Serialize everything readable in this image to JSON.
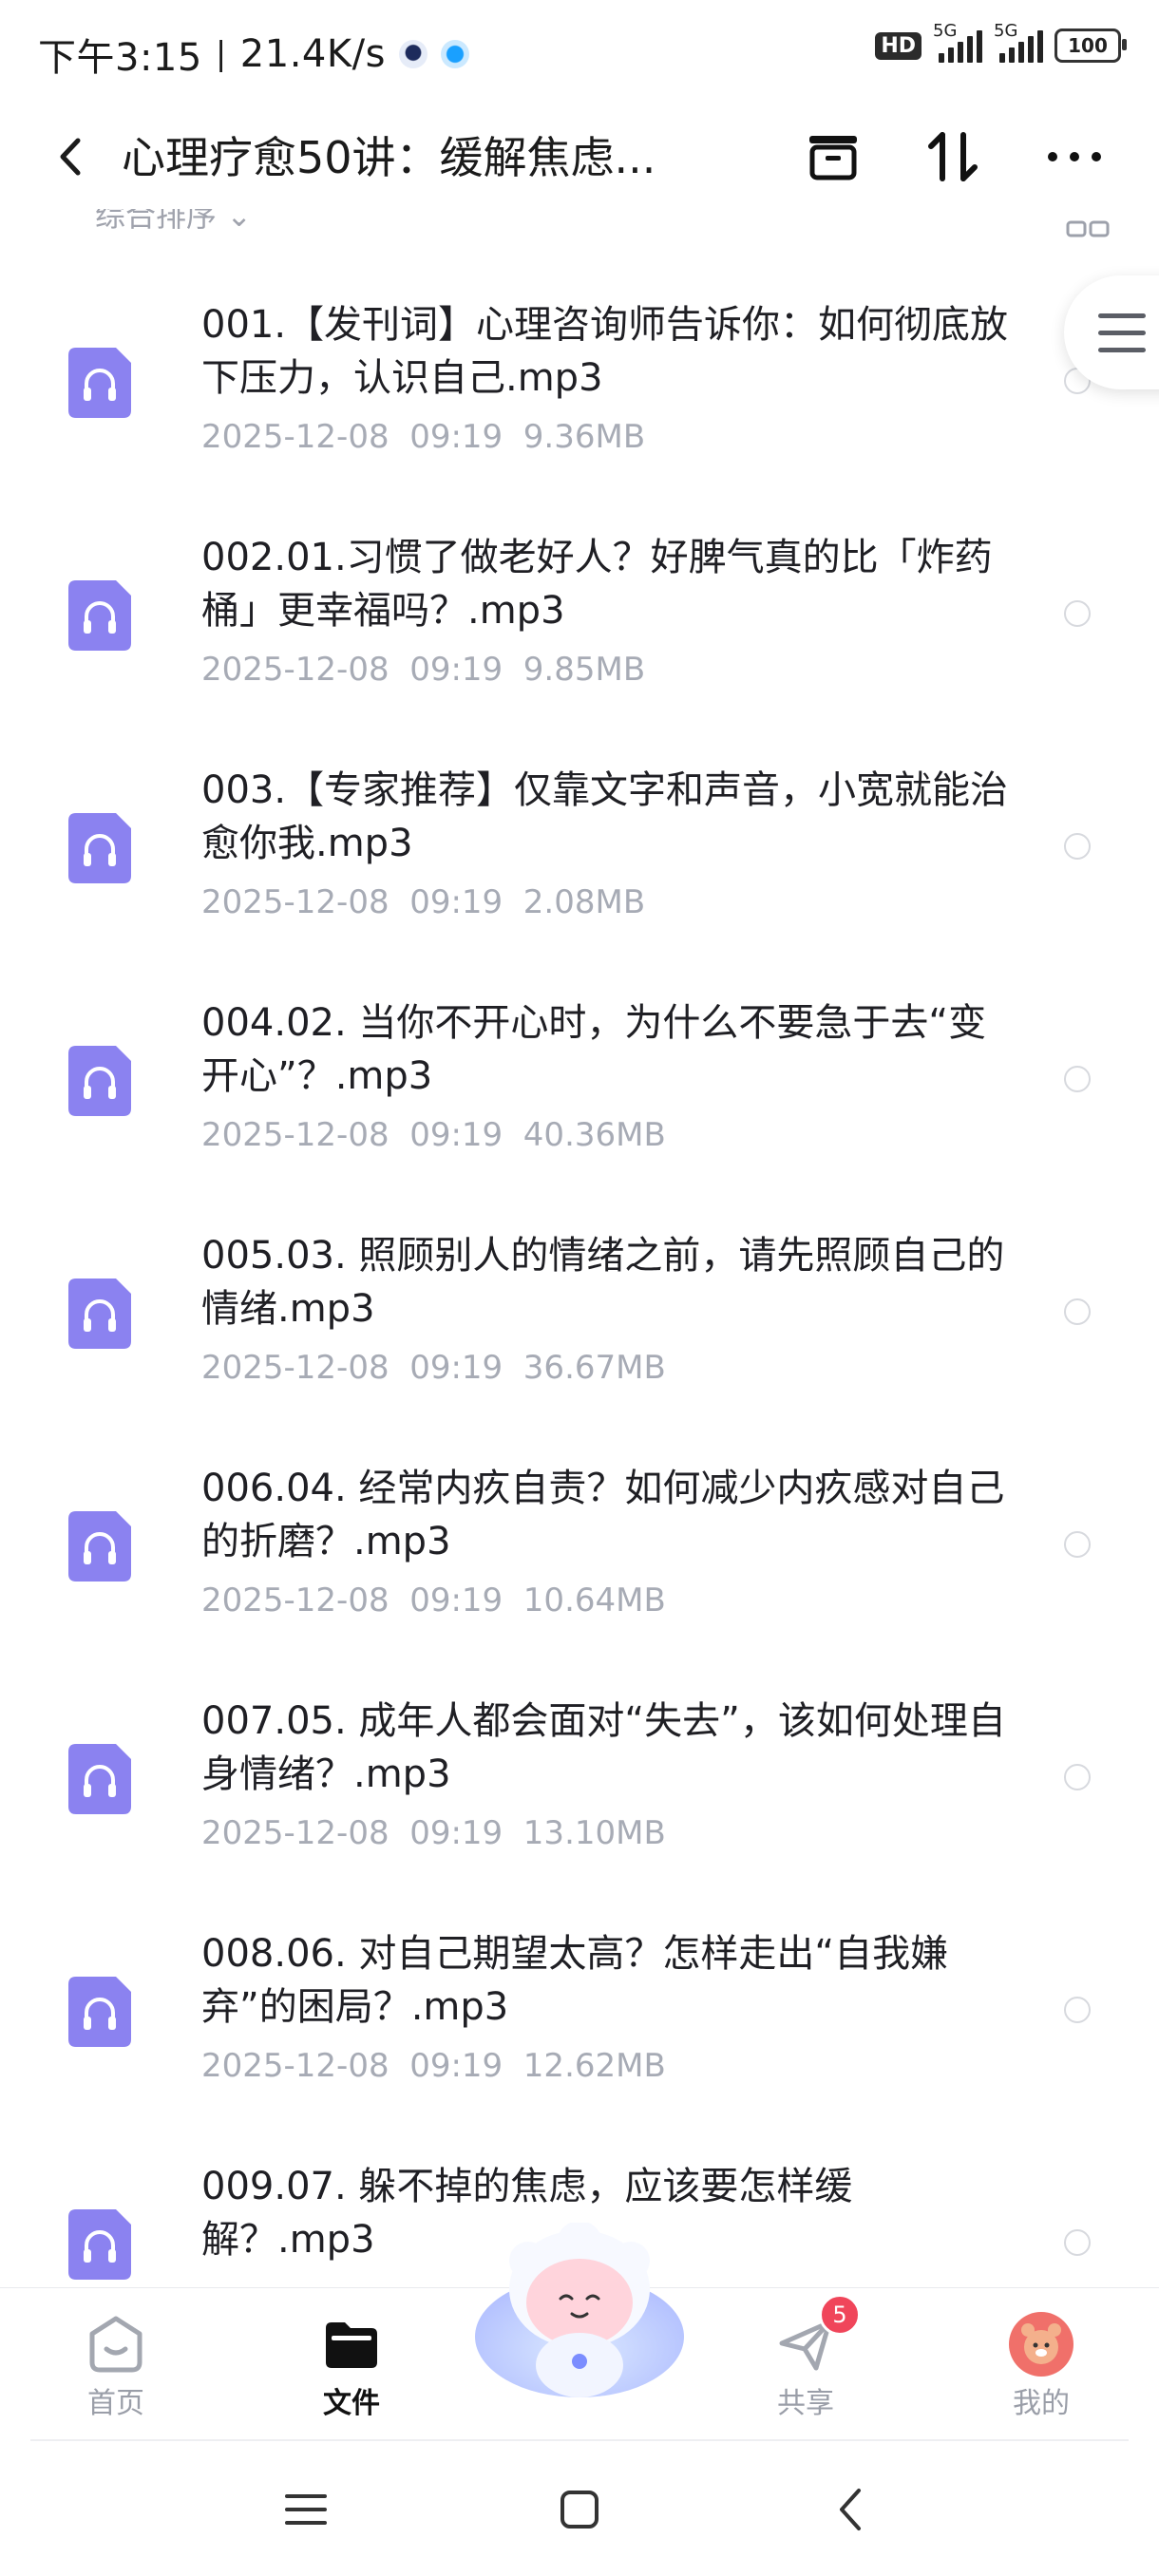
{
  "status_bar": {
    "time": "下午3:15",
    "net_speed": "21.4K/s",
    "hd_badge": "HD",
    "net_type_1": "5G",
    "net_type_2": "5G",
    "battery": "100"
  },
  "header": {
    "title": "心理疗愈50讲：缓解焦虑..."
  },
  "subheader": {
    "sort_label": "综合排序"
  },
  "files": [
    {
      "name": "001.【发刊词】心理咨询师告诉你：如何彻底放下压力，认识自己.mp3",
      "meta": "2025-12-08  09:19  9.36MB"
    },
    {
      "name": "002.01.习惯了做老好人？好脾气真的比「炸药桶」更幸福吗？.mp3",
      "meta": "2025-12-08  09:19  9.85MB"
    },
    {
      "name": "003.【专家推荐】仅靠文字和声音，小宽就能治愈你我.mp3",
      "meta": "2025-12-08  09:19  2.08MB"
    },
    {
      "name": "004.02. 当你不开心时，为什么不要急于去“变开心”？.mp3",
      "meta": "2025-12-08  09:19  40.36MB"
    },
    {
      "name": "005.03. 照顾别人的情绪之前，请先照顾自己的情绪.mp3",
      "meta": "2025-12-08  09:19  36.67MB"
    },
    {
      "name": "006.04. 经常内疚自责？如何减少内疚感对自己的折磨？.mp3",
      "meta": "2025-12-08  09:19  10.64MB"
    },
    {
      "name": "007.05. 成年人都会面对“失去”，该如何处理自身情绪？.mp3",
      "meta": "2025-12-08  09:19  13.10MB"
    },
    {
      "name": "008.06. 对自己期望太高？怎样走出“自我嫌弃”的困局？.mp3",
      "meta": "2025-12-08  09:19  12.62MB"
    },
    {
      "name": "009.07. 躲不掉的焦虑，应该要怎样缓解？.mp3",
      "meta": ""
    }
  ],
  "bottom_nav": {
    "home": "首页",
    "files": "文件",
    "share": "共享",
    "mine": "我的",
    "share_badge": "5"
  },
  "colors": {
    "audio_icon": "#8b82f0",
    "badge": "#f0455a",
    "meta_text": "#a7abb5"
  }
}
